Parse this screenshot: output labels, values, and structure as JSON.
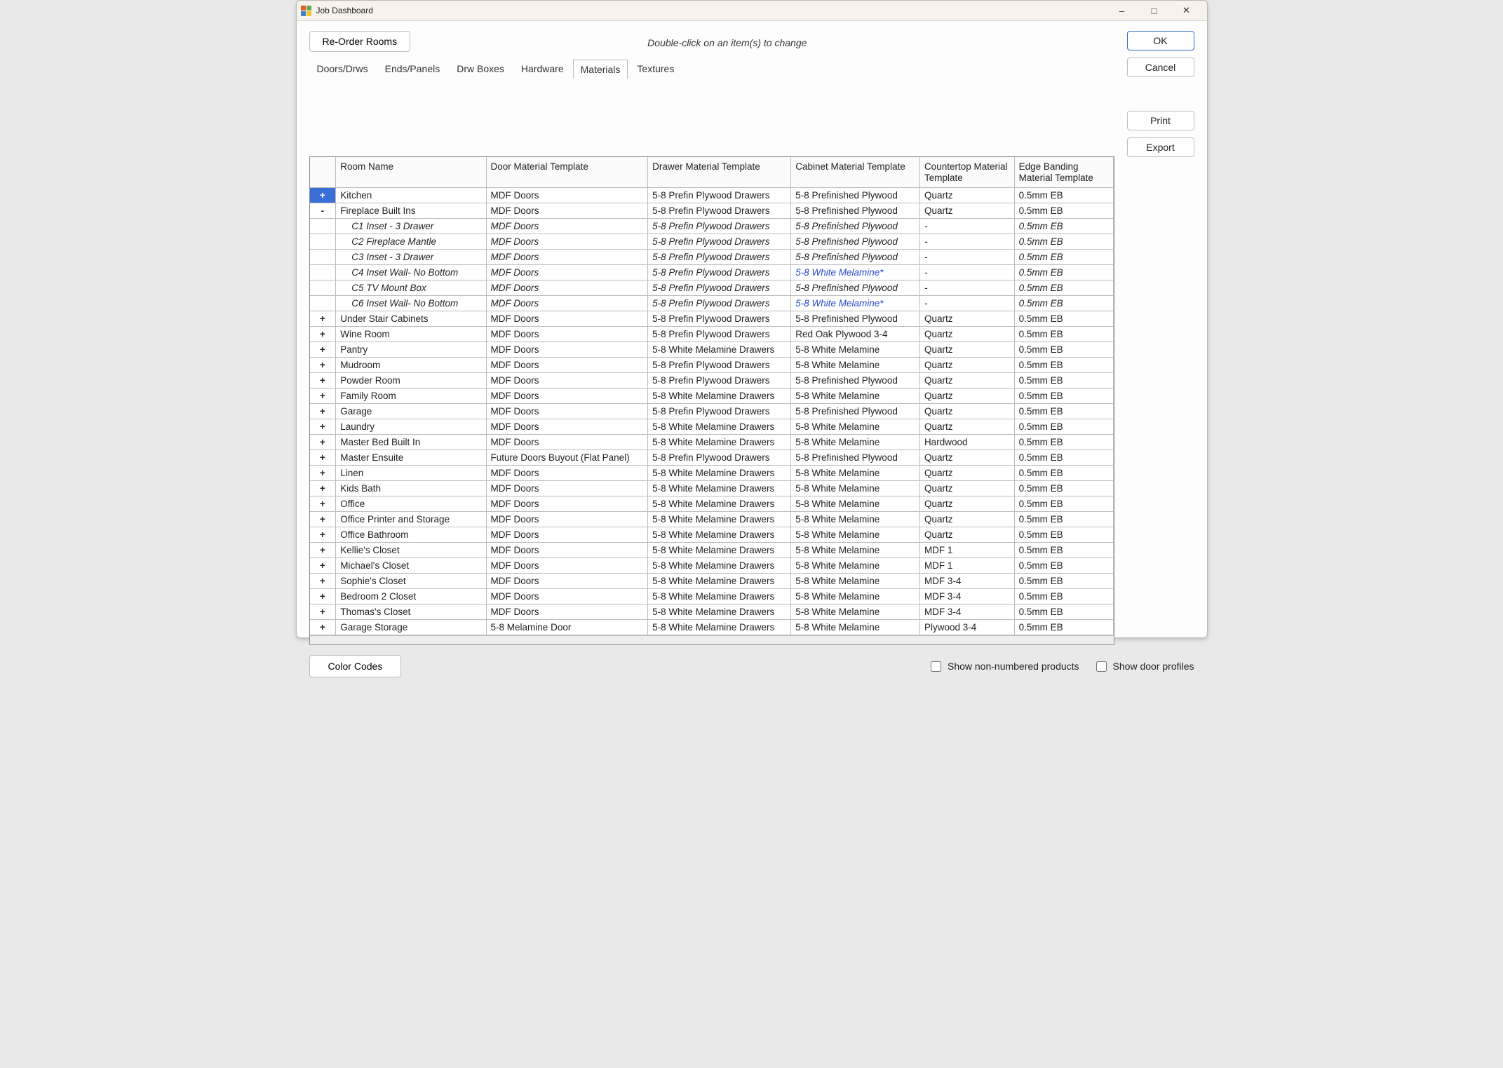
{
  "window": {
    "title": "Job Dashboard"
  },
  "buttons": {
    "reorder": "Re-Order Rooms",
    "ok": "OK",
    "cancel": "Cancel",
    "print": "Print",
    "export": "Export",
    "color_codes": "Color Codes"
  },
  "hint": "Double-click on an item(s) to change",
  "tabs": [
    "Doors/Drws",
    "Ends/Panels",
    "Drw Boxes",
    "Hardware",
    "Materials",
    "Textures"
  ],
  "active_tab_index": 4,
  "columns": [
    "",
    "Room Name",
    "Door Material Template",
    "Drawer Material Template",
    "Cabinet Material Template",
    "Countertop Material Template",
    "Edge Banding Material Template"
  ],
  "rows": [
    {
      "type": "room",
      "expander": "+",
      "expander_style": "blue",
      "cells": [
        "Kitchen",
        "MDF Doors",
        "5-8 Prefin Plywood Drawers",
        "5-8 Prefinished Plywood",
        "Quartz",
        "0.5mm EB"
      ]
    },
    {
      "type": "room",
      "expander": "-",
      "cells": [
        "Fireplace Built Ins",
        "MDF Doors",
        "5-8 Prefin Plywood Drawers",
        "5-8 Prefinished Plywood",
        "Quartz",
        "0.5mm EB"
      ]
    },
    {
      "type": "child",
      "cells": [
        "C1 Inset - 3 Drawer",
        "MDF Doors",
        "5-8 Prefin Plywood Drawers",
        "5-8 Prefinished Plywood",
        "-",
        "0.5mm EB"
      ]
    },
    {
      "type": "child",
      "cells": [
        "C2 Fireplace Mantle",
        "MDF Doors",
        "5-8 Prefin Plywood Drawers",
        "5-8 Prefinished Plywood",
        "-",
        "0.5mm EB"
      ]
    },
    {
      "type": "child",
      "cells": [
        "C3 Inset - 3 Drawer",
        "MDF Doors",
        "5-8 Prefin Plywood Drawers",
        "5-8 Prefinished Plywood",
        "-",
        "0.5mm EB"
      ]
    },
    {
      "type": "child",
      "cells": [
        "C4 Inset Wall- No Bottom",
        "MDF Doors",
        "5-8 Prefin Plywood Drawers",
        "5-8 White Melamine*",
        "-",
        "0.5mm EB"
      ],
      "override_cols": [
        3
      ]
    },
    {
      "type": "child",
      "cells": [
        "C5 TV Mount Box",
        "MDF Doors",
        "5-8 Prefin Plywood Drawers",
        "5-8 Prefinished Plywood",
        "-",
        "0.5mm EB"
      ]
    },
    {
      "type": "child",
      "cells": [
        "C6 Inset Wall- No Bottom",
        "MDF Doors",
        "5-8 Prefin Plywood Drawers",
        "5-8 White Melamine*",
        "-",
        "0.5mm EB"
      ],
      "override_cols": [
        3
      ]
    },
    {
      "type": "room",
      "expander": "+",
      "cells": [
        "Under Stair Cabinets",
        "MDF Doors",
        "5-8 Prefin Plywood Drawers",
        "5-8 Prefinished Plywood",
        "Quartz",
        "0.5mm EB"
      ]
    },
    {
      "type": "room",
      "expander": "+",
      "cells": [
        "Wine Room",
        "MDF Doors",
        "5-8 Prefin Plywood Drawers",
        "Red Oak Plywood 3-4",
        "Quartz",
        "0.5mm EB"
      ]
    },
    {
      "type": "room",
      "expander": "+",
      "cells": [
        "Pantry",
        "MDF Doors",
        "5-8 White Melamine Drawers",
        "5-8 White Melamine",
        "Quartz",
        "0.5mm EB"
      ]
    },
    {
      "type": "room",
      "expander": "+",
      "cells": [
        "Mudroom",
        "MDF Doors",
        "5-8 Prefin Plywood Drawers",
        "5-8 White Melamine",
        "Quartz",
        "0.5mm EB"
      ]
    },
    {
      "type": "room",
      "expander": "+",
      "cells": [
        "Powder Room",
        "MDF Doors",
        "5-8 Prefin Plywood Drawers",
        "5-8 Prefinished Plywood",
        "Quartz",
        "0.5mm EB"
      ]
    },
    {
      "type": "room",
      "expander": "+",
      "cells": [
        "Family Room",
        "MDF Doors",
        "5-8 White Melamine Drawers",
        "5-8 White Melamine",
        "Quartz",
        "0.5mm EB"
      ]
    },
    {
      "type": "room",
      "expander": "+",
      "cells": [
        "Garage",
        "MDF Doors",
        "5-8 Prefin Plywood Drawers",
        "5-8 Prefinished Plywood",
        "Quartz",
        "0.5mm EB"
      ]
    },
    {
      "type": "room",
      "expander": "+",
      "cells": [
        "Laundry",
        "MDF Doors",
        "5-8 White Melamine Drawers",
        "5-8 White Melamine",
        "Quartz",
        "0.5mm EB"
      ]
    },
    {
      "type": "room",
      "expander": "+",
      "cells": [
        "Master Bed Built In",
        "MDF Doors",
        "5-8 White Melamine Drawers",
        "5-8 White Melamine",
        "Hardwood",
        "0.5mm EB"
      ]
    },
    {
      "type": "room",
      "expander": "+",
      "cells": [
        "Master Ensuite",
        "Future Doors Buyout (Flat Panel)",
        "5-8 Prefin Plywood Drawers",
        "5-8 Prefinished Plywood",
        "Quartz",
        "0.5mm EB"
      ]
    },
    {
      "type": "room",
      "expander": "+",
      "cells": [
        "Linen",
        "MDF Doors",
        "5-8 White Melamine Drawers",
        "5-8 White Melamine",
        "Quartz",
        "0.5mm EB"
      ]
    },
    {
      "type": "room",
      "expander": "+",
      "cells": [
        "Kids Bath",
        "MDF Doors",
        "5-8 White Melamine Drawers",
        "5-8 White Melamine",
        "Quartz",
        "0.5mm EB"
      ]
    },
    {
      "type": "room",
      "expander": "+",
      "cells": [
        "Office",
        "MDF Doors",
        "5-8 White Melamine Drawers",
        "5-8 White Melamine",
        "Quartz",
        "0.5mm EB"
      ]
    },
    {
      "type": "room",
      "expander": "+",
      "cells": [
        "Office Printer and Storage",
        "MDF Doors",
        "5-8 White Melamine Drawers",
        "5-8 White Melamine",
        "Quartz",
        "0.5mm EB"
      ]
    },
    {
      "type": "room",
      "expander": "+",
      "cells": [
        "Office Bathroom",
        "MDF Doors",
        "5-8 White Melamine Drawers",
        "5-8 White Melamine",
        "Quartz",
        "0.5mm EB"
      ]
    },
    {
      "type": "room",
      "expander": "+",
      "cells": [
        "Kellie's Closet",
        "MDF Doors",
        "5-8 White Melamine Drawers",
        "5-8 White Melamine",
        "MDF 1",
        "0.5mm EB"
      ]
    },
    {
      "type": "room",
      "expander": "+",
      "cells": [
        "Michael's Closet",
        "MDF Doors",
        "5-8 White Melamine Drawers",
        "5-8 White Melamine",
        "MDF 1",
        "0.5mm EB"
      ]
    },
    {
      "type": "room",
      "expander": "+",
      "cells": [
        "Sophie's Closet",
        "MDF Doors",
        "5-8 White Melamine Drawers",
        "5-8 White Melamine",
        "MDF 3-4",
        "0.5mm EB"
      ]
    },
    {
      "type": "room",
      "expander": "+",
      "cells": [
        "Bedroom 2 Closet",
        "MDF Doors",
        "5-8 White Melamine Drawers",
        "5-8 White Melamine",
        "MDF 3-4",
        "0.5mm EB"
      ]
    },
    {
      "type": "room",
      "expander": "+",
      "cells": [
        "Thomas's Closet",
        "MDF Doors",
        "5-8 White Melamine Drawers",
        "5-8 White Melamine",
        "MDF 3-4",
        "0.5mm EB"
      ]
    },
    {
      "type": "room",
      "expander": "+",
      "cells": [
        "Garage Storage",
        "5-8 Melamine Door",
        "5-8 White Melamine Drawers",
        "5-8 White Melamine",
        "Plywood 3-4",
        "0.5mm EB"
      ]
    }
  ],
  "footer": {
    "show_non_numbered": "Show non-numbered products",
    "show_door_profiles": "Show door profiles"
  }
}
